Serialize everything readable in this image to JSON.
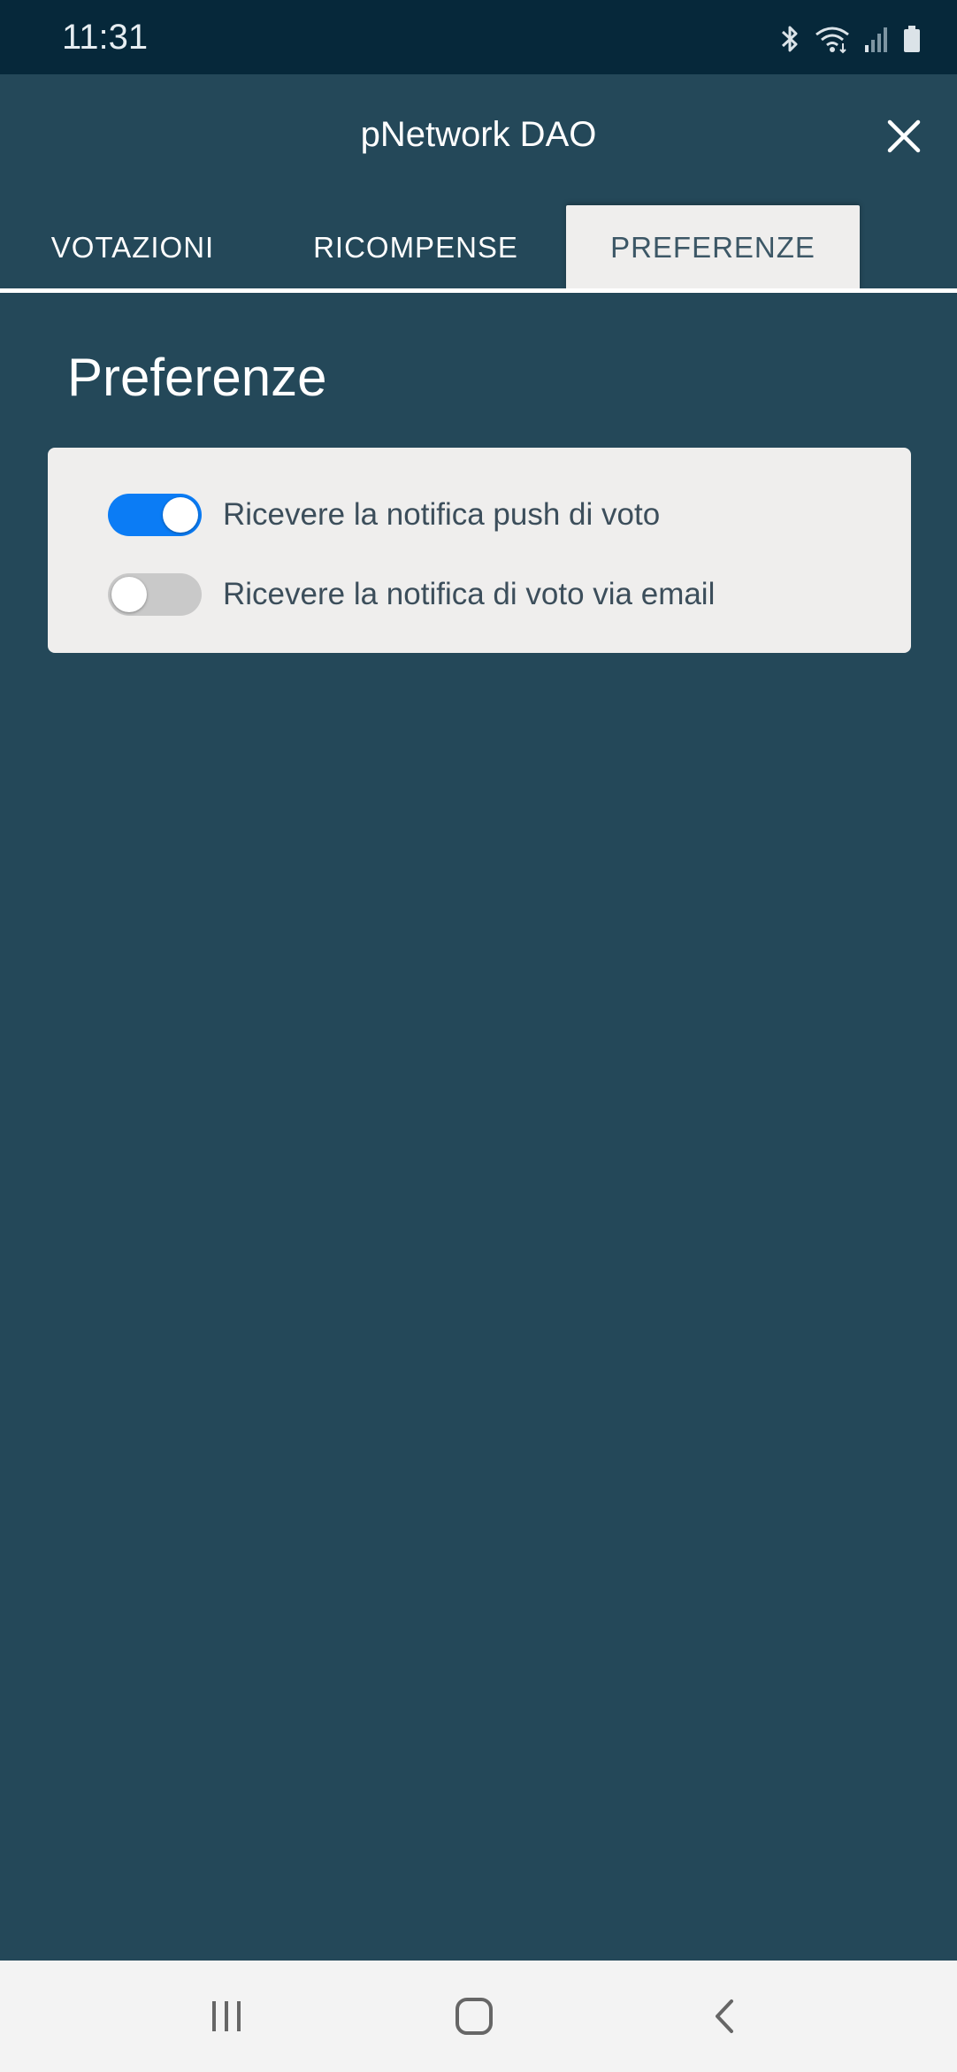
{
  "status_bar": {
    "time": "11:31",
    "icons": [
      "bluetooth-icon",
      "wifi-icon",
      "signal-icon",
      "battery-icon"
    ]
  },
  "header": {
    "title": "pNetwork DAO",
    "close_icon": "close-icon"
  },
  "tabs": [
    {
      "label": "VOTAZIONI",
      "active": false
    },
    {
      "label": "RICOMPENSE",
      "active": false
    },
    {
      "label": "PREFERENZE",
      "active": true
    }
  ],
  "page": {
    "title": "Preferenze"
  },
  "preferences": [
    {
      "label": "Ricevere la notifica push di voto",
      "enabled": true
    },
    {
      "label": "Ricevere la notifica di voto via email",
      "enabled": false
    }
  ],
  "nav_bar": {
    "icons": [
      "recents-icon",
      "home-icon",
      "back-icon"
    ]
  },
  "colors": {
    "background": "#244859",
    "status_bar": "#06283A",
    "card": "#efeeed",
    "toggle_on": "#0b7cf5",
    "toggle_off": "#c9c9c9",
    "nav_bar": "#f3f3f3"
  }
}
